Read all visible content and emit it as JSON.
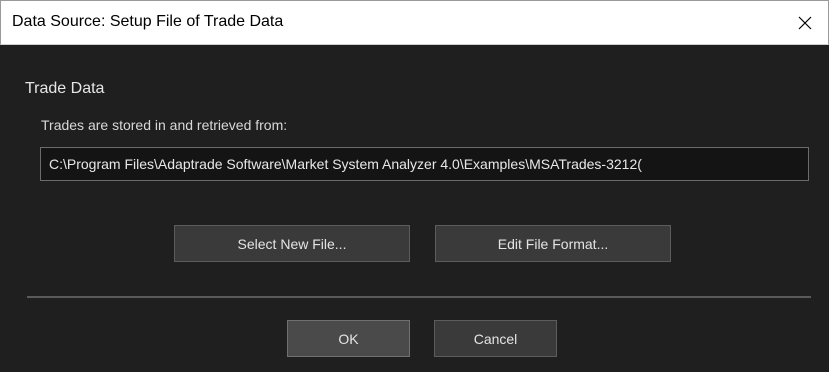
{
  "window": {
    "title": "Data Source: Setup File of Trade Data",
    "close_icon": "close-icon"
  },
  "group": {
    "title": "Trade Data",
    "description": "Trades are stored in and retrieved from:",
    "file_path": "C:\\Program Files\\Adaptrade Software\\Market System Analyzer 4.0\\Examples\\MSATrades-3212("
  },
  "buttons": {
    "select_new_file": "Select New File...",
    "edit_file_format": "Edit File Format...",
    "ok": "OK",
    "cancel": "Cancel"
  },
  "colors": {
    "dialog_background": "#1f1f1f",
    "titlebar_background": "#ffffff",
    "button_background": "#3a3a3a",
    "text": "#e6e6e6"
  }
}
